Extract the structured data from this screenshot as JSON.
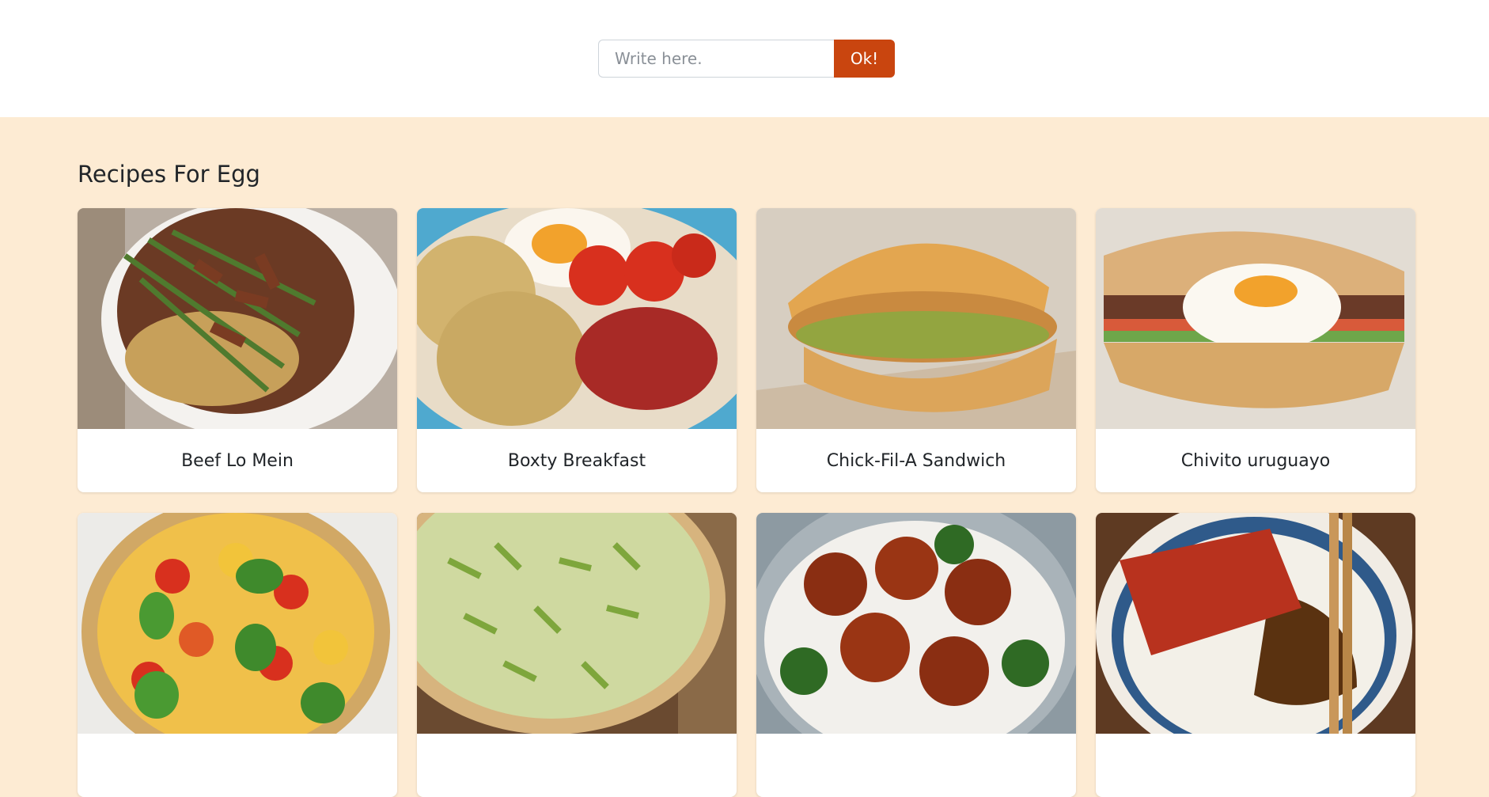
{
  "search": {
    "placeholder": "Write here.",
    "value": "",
    "button_label": "Ok!"
  },
  "section": {
    "title": "Recipes For Egg"
  },
  "recipes": [
    {
      "name": "Beef Lo Mein",
      "icon": "food-photo"
    },
    {
      "name": "Boxty Breakfast",
      "icon": "food-photo"
    },
    {
      "name": "Chick-Fil-A Sandwich",
      "icon": "food-photo"
    },
    {
      "name": "Chivito uruguayo",
      "icon": "food-photo"
    },
    {
      "name": "",
      "icon": "food-photo"
    },
    {
      "name": "",
      "icon": "food-photo"
    },
    {
      "name": "",
      "icon": "food-photo"
    },
    {
      "name": "",
      "icon": "food-photo"
    }
  ],
  "colors": {
    "accent": "#c9450f",
    "page_bg": "#fdebd3",
    "card_bg": "#ffffff"
  }
}
